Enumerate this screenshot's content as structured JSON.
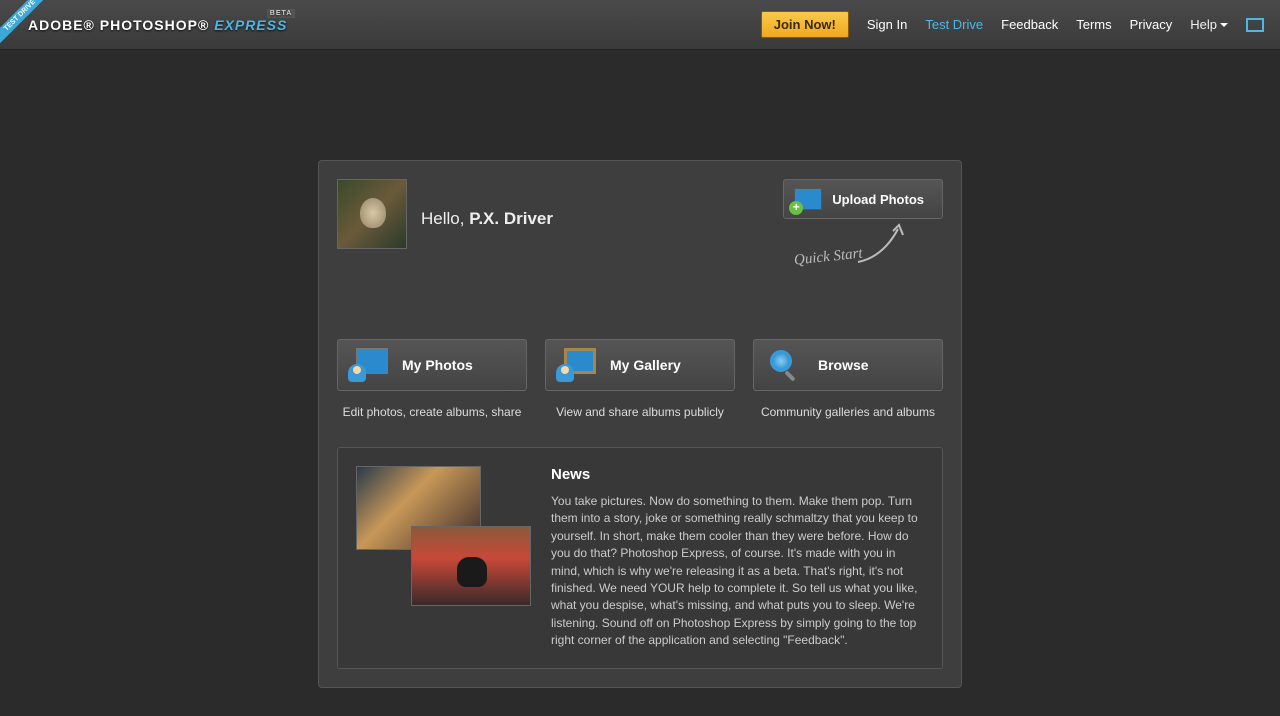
{
  "header": {
    "logo_brand": "ADOBE®",
    "logo_product": "PHOTOSHOP®",
    "logo_express": "EXPRESS",
    "beta": "BETA",
    "ribbon": "TEST DRIVE",
    "join": "Join Now!",
    "links": {
      "signin": "Sign In",
      "testdrive": "Test Drive",
      "feedback": "Feedback",
      "terms": "Terms",
      "privacy": "Privacy",
      "help": "Help"
    }
  },
  "greeting": {
    "hello": "Hello, ",
    "name": "P.X. Driver"
  },
  "upload": {
    "label": "Upload Photos"
  },
  "quickstart": "Quick Start",
  "tiles": {
    "myphotos": {
      "label": "My Photos",
      "desc": "Edit photos, create albums, share"
    },
    "mygallery": {
      "label": "My Gallery",
      "desc": "View and share albums publicly"
    },
    "browse": {
      "label": "Browse",
      "desc": "Community galleries and albums"
    }
  },
  "news": {
    "title": "News",
    "body": "You take pictures. Now do something to them. Make them pop. Turn them into a story, joke or something really schmaltzy that you keep to yourself. In short, make them cooler than they were before. How do you do that? Photoshop Express, of course. It's made with you in mind, which is why we're releasing it as a beta. That's right, it's not finished. We need YOUR help to complete it. So tell us what you like, what you despise, what's missing, and what puts you to sleep. We're listening. Sound off on Photoshop Express by simply going to the top right corner of the application and selecting \"Feedback\"."
  }
}
